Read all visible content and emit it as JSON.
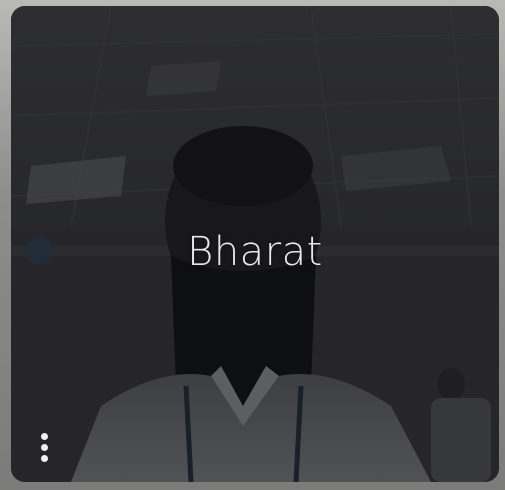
{
  "participant": {
    "name": "Bharat"
  },
  "controls": {
    "more_icon": "more-vert-icon"
  },
  "colors": {
    "tile_background": "#1f2022",
    "name_text": "#e8e8e8",
    "icon": "#f2f2f2"
  }
}
